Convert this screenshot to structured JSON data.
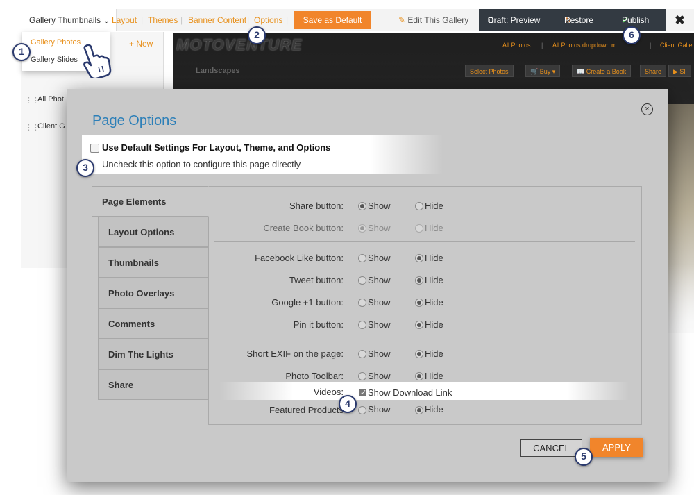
{
  "toolbar": {
    "dropdown_label": "Gallery Thumbnails",
    "links": [
      "Layout",
      "Themes",
      "Banner Content",
      "Options"
    ],
    "separator": "|",
    "save_default": "Save as Default",
    "edit_gallery": "Edit This Gallery",
    "draft_preview": "Draft: Preview",
    "restore": "Restore",
    "publish": "Publish",
    "close": "✖"
  },
  "dropdown_menu": {
    "items": [
      "Gallery Photos",
      "Gallery Slides"
    ]
  },
  "sidebar": {
    "new_label": "+ New",
    "items": [
      "All Phot",
      "Client G"
    ]
  },
  "gallery": {
    "logo": "MOTOVENTURE",
    "nav": [
      "All Photos",
      "All Photos dropdown m",
      "Client Galle"
    ],
    "nav_sep": "|",
    "section": "Landscapes",
    "buttons": [
      "Select Photos",
      "Buy ▾",
      "Create a Book",
      "Share",
      "▶ Sli"
    ]
  },
  "modal": {
    "title": "Page Options",
    "close": "×",
    "use_default_label": "Use Default Settings For Layout, Theme, and Options",
    "use_default_hint": "Uncheck this option to configure this page directly",
    "use_default_checked": false,
    "tabs": [
      "Page Elements",
      "Layout Options",
      "Thumbnails",
      "Photo Overlays",
      "Comments",
      "Dim The Lights",
      "Share"
    ],
    "active_tab": "Page Elements",
    "show_label": "Show",
    "hide_label": "Hide",
    "rows": [
      {
        "label": "Share button:",
        "value": "Show",
        "disabled": false
      },
      {
        "label": "Create Book button:",
        "value": "Show",
        "disabled": true
      },
      {
        "label": "Facebook Like button:",
        "value": "Hide",
        "disabled": false
      },
      {
        "label": "Tweet button:",
        "value": "Hide",
        "disabled": false
      },
      {
        "label": "Google +1 button:",
        "value": "Hide",
        "disabled": false
      },
      {
        "label": "Pin it button:",
        "value": "Hide",
        "disabled": false
      },
      {
        "label": "Short EXIF on the page:",
        "value": "Hide",
        "disabled": false
      },
      {
        "label": "Photo Toolbar:",
        "value": "Hide",
        "disabled": false
      }
    ],
    "videos_label": "Videos:",
    "videos_checkbox_label": "Show Download Link",
    "videos_checked": true,
    "featured_label": "Featured Products",
    "featured_value": "Hide",
    "cancel": "CANCEL",
    "apply": "APPLY"
  },
  "steps": [
    "1",
    "2",
    "3",
    "4",
    "5",
    "6"
  ],
  "colors": {
    "accent": "#f1852b",
    "link": "#e8911d",
    "title": "#2c7fb8",
    "dark_bar": "#333a42",
    "step_ring": "#2b3a6e"
  }
}
